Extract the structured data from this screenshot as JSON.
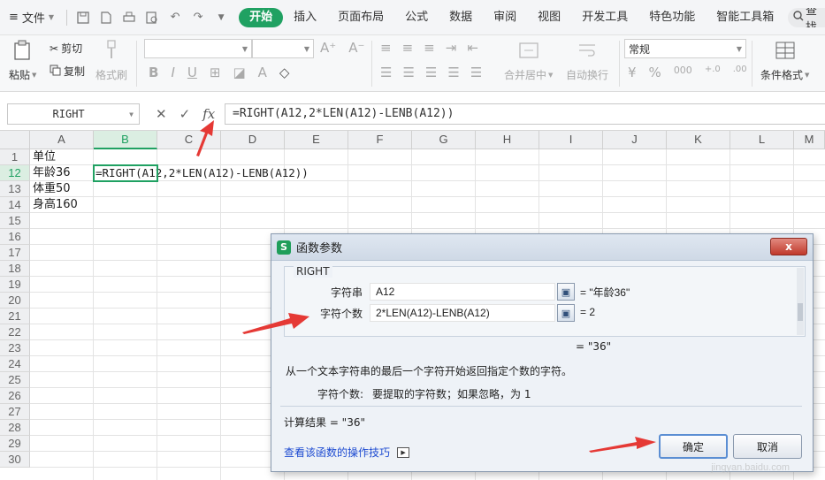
{
  "menubar": {
    "file_label": "文件",
    "tabs": [
      "开始",
      "插入",
      "页面布局",
      "公式",
      "数据",
      "审阅",
      "视图",
      "开发工具",
      "特色功能",
      "智能工具箱"
    ],
    "active_tab": "开始",
    "search_label": "查找"
  },
  "ribbon": {
    "paste_label": "粘贴",
    "cut_label": "剪切",
    "copy_label": "复制",
    "format_painter_label": "格式刷",
    "merge_center_label": "合并居中",
    "wrap_text_label": "自动换行",
    "number_format_value": "常规",
    "conditional_format_label": "条件格式"
  },
  "formula_bar": {
    "name_box": "RIGHT",
    "fx_label": "fx",
    "formula": "=RIGHT(A12,2*LEN(A12)-LENB(A12))"
  },
  "grid": {
    "columns": [
      "A",
      "B",
      "C",
      "D",
      "E",
      "F",
      "G",
      "H",
      "I",
      "J",
      "K",
      "L",
      "M"
    ],
    "selected_column": "B",
    "rows": [
      "1",
      "12",
      "13",
      "14",
      "15",
      "16",
      "17",
      "18",
      "19",
      "20",
      "21",
      "22",
      "23",
      "24",
      "25",
      "26",
      "27",
      "28",
      "29",
      "30"
    ],
    "selected_row": "12",
    "cells": {
      "A1": "单位",
      "A12": "年龄36",
      "A13": "体重50",
      "A14": "身高160",
      "B12": "=RIGHT(A12,2*LEN(A12)-LENB(A12))"
    }
  },
  "dialog": {
    "title": "函数参数",
    "logo": "S",
    "close": "x",
    "function_name": "RIGHT",
    "args": [
      {
        "label": "字符串",
        "value": "A12",
        "result": "= \"年龄36\""
      },
      {
        "label": "字符个数",
        "value": "2*LEN(A12)-LENB(A12)",
        "result": "= 2"
      }
    ],
    "overall_result": "= \"36\"",
    "description": "从一个文本字符串的最后一个字符开始返回指定个数的字符。",
    "arg_help_label": "字符个数:",
    "arg_help_text": "要提取的字符数；如果忽略，为 1",
    "calc_result": "计算结果 = \"36\"",
    "help_link": "查看该函数的操作技巧",
    "ok_label": "确定",
    "cancel_label": "取消"
  },
  "colors": {
    "accent_green": "#20a162",
    "annotation_red": "#e53935",
    "link_blue": "#1d4bd1"
  },
  "watermark": "jingyan.baidu.com"
}
